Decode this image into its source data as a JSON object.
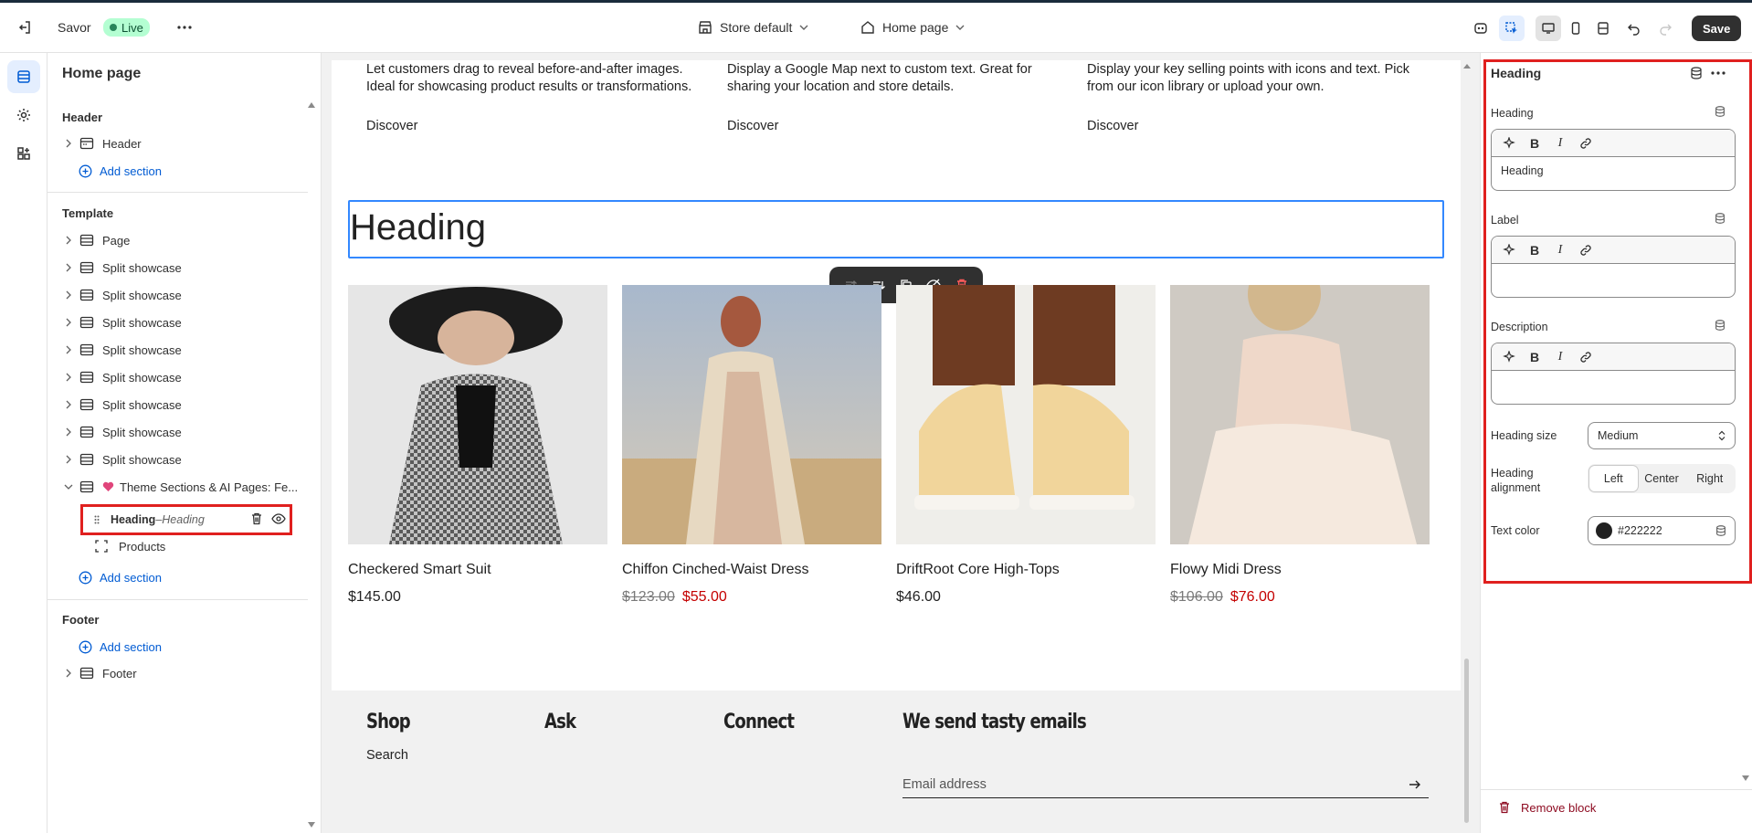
{
  "colors": {
    "accent": "#005bd3",
    "danger": "#e0201f",
    "text_color_value": "#222222",
    "live_bg": "#b4fed2",
    "price_sale": "#c40000"
  },
  "topbar": {
    "exit_icon": "exit-icon",
    "store_name": "Savor",
    "live_label": "Live",
    "more_icon": "ellipsis-icon",
    "theme_dropdown": "Store default",
    "page_dropdown": "Home page",
    "save_label": "Save"
  },
  "rail": {
    "items": [
      "sections-icon",
      "settings-icon",
      "apps-icon"
    ]
  },
  "sidebar": {
    "title": "Home page",
    "header_group": "Header",
    "header_item": "Header",
    "add_section": "Add section",
    "template_group": "Template",
    "template_items": [
      "Page",
      "Split showcase",
      "Split showcase",
      "Split showcase",
      "Split showcase",
      "Split showcase",
      "Split showcase",
      "Split showcase",
      "Split showcase"
    ],
    "theme_section": "Theme Sections & AI Pages: Fe...",
    "selected_block": {
      "name": "Heading",
      "separator": " – ",
      "sub": "Heading"
    },
    "products_block": "Products",
    "footer_group": "Footer",
    "footer_item": "Footer"
  },
  "canvas": {
    "features": [
      {
        "text": "Let customers drag to reveal before-and-after images. Ideal for showcasing product results or transformations.",
        "link": "Discover"
      },
      {
        "text": "Display a Google Map next to custom text. Great for sharing your location and store details.",
        "link": "Discover"
      },
      {
        "text": "Display your key selling points with icons and text. Pick from our icon library or upload your own.",
        "link": "Discover"
      }
    ],
    "heading": "Heading",
    "products": [
      {
        "name": "Checkered Smart Suit",
        "price": "$145.00",
        "compare": ""
      },
      {
        "name": "Chiffon Cinched-Waist Dress",
        "price": "$55.00",
        "compare": "$123.00"
      },
      {
        "name": "DriftRoot Core High-Tops",
        "price": "$46.00",
        "compare": ""
      },
      {
        "name": "Flowy Midi Dress",
        "price": "$76.00",
        "compare": "$106.00"
      }
    ],
    "footer": {
      "shop": "Shop",
      "search_link": "Search",
      "ask": "Ask",
      "connect": "Connect",
      "newsletter": "We send tasty emails",
      "email_placeholder": "Email address"
    }
  },
  "panel": {
    "title": "Heading",
    "heading_label": "Heading",
    "heading_value": "Heading",
    "label_label": "Label",
    "label_value": "",
    "description_label": "Description",
    "description_value": "",
    "heading_size_label": "Heading size",
    "heading_size_value": "Medium",
    "alignment_label": "Heading alignment",
    "alignment_options": [
      "Left",
      "Center",
      "Right"
    ],
    "alignment_selected": "Left",
    "text_color_label": "Text color",
    "text_color_value": "#222222",
    "remove_label": "Remove block"
  }
}
